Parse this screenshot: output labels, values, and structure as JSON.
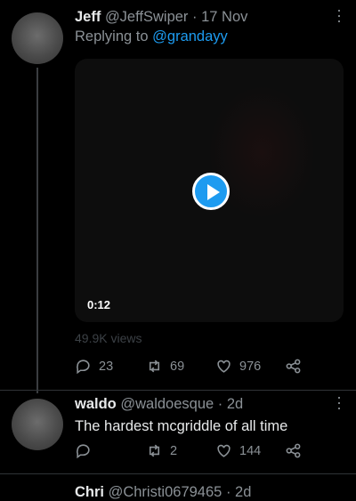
{
  "tweets": [
    {
      "name": "Jeff",
      "handle": "@JeffSwiper",
      "sep": "·",
      "date": "17 Nov",
      "replying_prefix": "Replying to",
      "replying_to": "@grandayy",
      "video": {
        "duration": "0:12",
        "play_icon": "play-icon"
      },
      "views": "49.9K views",
      "replies": "23",
      "retweets": "69",
      "likes": "976"
    },
    {
      "name": "waldo",
      "handle": "@waldoesque",
      "sep": "·",
      "date": "2d",
      "text": "The hardest mcgriddle of all time",
      "replies": "",
      "retweets": "2",
      "likes": "144"
    },
    {
      "name": "Chri",
      "handle": "@Christi0679465",
      "sep": "·",
      "date": "2d"
    }
  ],
  "colors": {
    "accent": "#1d9bf0",
    "muted": "#8b9196",
    "background": "#000000"
  },
  "icons": [
    "reply-icon",
    "retweet-icon",
    "like-icon",
    "share-icon",
    "more-icon"
  ]
}
